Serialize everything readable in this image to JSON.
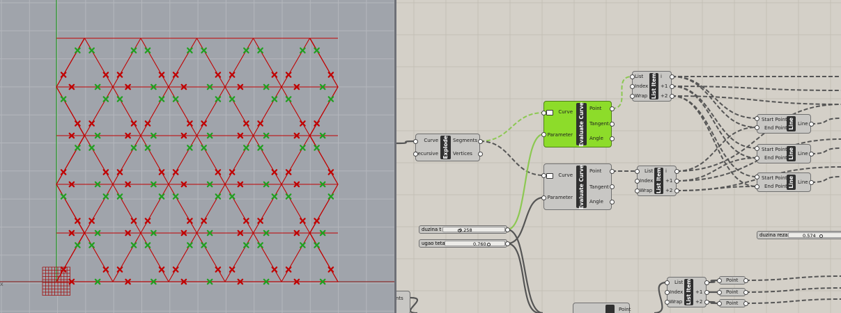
{
  "rhino_viewport": {
    "axis_label": "x",
    "colors": {
      "background": "#a0a4ab",
      "curves": "#c00000",
      "green_marker": "#20a020",
      "red_marker": "#c00000",
      "axis_green": "#2a9a2a"
    }
  },
  "grasshopper": {
    "components": {
      "explode": {
        "name": "Explode",
        "inputs": [
          "Curve",
          "Recursive"
        ],
        "outputs": [
          "Segments",
          "Vertices"
        ]
      },
      "evaluate_curve_1": {
        "name": "Evaluate Curve",
        "inputs": [
          "Curve",
          "Parameter"
        ],
        "outputs": [
          "Point",
          "Tangent",
          "Angle"
        ],
        "selected": true
      },
      "evaluate_curve_2": {
        "name": "Evaluate Curve",
        "inputs": [
          "Curve",
          "Parameter"
        ],
        "outputs": [
          "Point",
          "Tangent",
          "Angle"
        ]
      },
      "list_item_1": {
        "name": "List Item",
        "inputs": [
          "List",
          "Index",
          "Wrap"
        ],
        "outputs": [
          "i",
          "+1",
          "+2"
        ]
      },
      "list_item_2": {
        "name": "List Item",
        "inputs": [
          "List",
          "Index",
          "Wrap"
        ],
        "outputs": [
          "i",
          "+1",
          "+2"
        ]
      },
      "list_item_3": {
        "name": "List Item",
        "inputs": [
          "List",
          "Index",
          "Wrap"
        ],
        "outputs": [
          "",
          "+1",
          "+2"
        ]
      },
      "line_1": {
        "name": "Line",
        "inputs": [
          "Start Point",
          "End Point"
        ],
        "output": "Line"
      },
      "line_2": {
        "name": "Line",
        "inputs": [
          "Start Point",
          "End Point"
        ],
        "output": "Line"
      },
      "line_3": {
        "name": "Line",
        "inputs": [
          "Start Point",
          "End Point"
        ],
        "output": "Line"
      },
      "point_1": {
        "name": "Point"
      },
      "point_2": {
        "name": "Point"
      },
      "point_3": {
        "name": "Point"
      },
      "partial_left": {
        "label": "nts"
      },
      "partial_bottom": {
        "output": "Point"
      }
    },
    "sliders": {
      "duzina_t": {
        "name": "duzina t",
        "value": "0.258",
        "fraction": 0.258
      },
      "ugao_teta": {
        "name": "ugao teta",
        "value": "0.760",
        "fraction": 0.76
      },
      "duzina_reza": {
        "name": "duzina reza",
        "value": "0.574",
        "fraction": 0.574
      }
    },
    "colors": {
      "canvas": "#d4d0c8",
      "component": "#c8c7c4",
      "selected": "#8ddc2a",
      "wire": "#555555",
      "selected_wire": "#8cc852"
    }
  }
}
